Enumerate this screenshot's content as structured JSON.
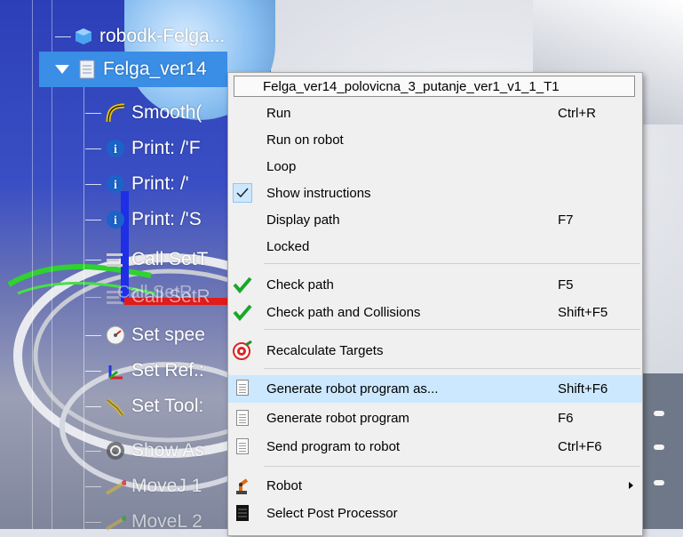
{
  "tree": {
    "items": [
      {
        "label": "robodk-Felga...",
        "icon": "cube-icon"
      },
      {
        "label": "Felga_ver14",
        "icon": "program-doc-icon"
      },
      {
        "label": "Smooth(",
        "icon": "smooth-curve-icon"
      },
      {
        "label": "Print: /'F",
        "icon": "info-icon"
      },
      {
        "label": "Print: /'",
        "icon": "info-icon"
      },
      {
        "label": "Print: /'S",
        "icon": "info-icon"
      },
      {
        "label": "Call SetT",
        "icon": "call-program-icon"
      },
      {
        "label": "Call SetR",
        "icon": "call-program-icon"
      },
      {
        "label": "Set spee",
        "icon": "speed-gauge-icon"
      },
      {
        "label": "Set Ref.:",
        "icon": "reference-frame-icon"
      },
      {
        "label": "Set Tool:",
        "icon": "tool-icon"
      },
      {
        "label": "Show As",
        "icon": "refresh-icon"
      },
      {
        "label": "MoveJ 1",
        "icon": "move-joint-icon"
      },
      {
        "label": "MoveL 2",
        "icon": "move-linear-icon"
      }
    ]
  },
  "viewport": {
    "overlay_text": "Call SetR"
  },
  "context_menu": {
    "title": "Felga_ver14_polovicna_3_putanje_ver1_v1_1_T1",
    "items": [
      {
        "label": "Run",
        "shortcut": "Ctrl+R"
      },
      {
        "label": "Run on robot",
        "shortcut": ""
      },
      {
        "label": "Loop",
        "shortcut": ""
      },
      {
        "label": "Show instructions",
        "shortcut": "",
        "checked": true
      },
      {
        "label": "Display path",
        "shortcut": "F7"
      },
      {
        "label": "Locked",
        "shortcut": ""
      },
      {
        "label": "Check path",
        "shortcut": "F5",
        "icon": "green-check-icon"
      },
      {
        "label": "Check path and Collisions",
        "shortcut": "Shift+F5",
        "icon": "green-check-icon"
      },
      {
        "label": "Recalculate Targets",
        "shortcut": "",
        "icon": "target-icon"
      },
      {
        "label": "Generate robot program as...",
        "shortcut": "Shift+F6",
        "icon": "document-icon",
        "highlighted": true
      },
      {
        "label": "Generate robot program",
        "shortcut": "F6",
        "icon": "document-icon"
      },
      {
        "label": "Send program to robot",
        "shortcut": "Ctrl+F6",
        "icon": "document-icon"
      },
      {
        "label": "Robot",
        "shortcut": "",
        "icon": "robot-arm-icon",
        "submenu": true
      },
      {
        "label": "Select Post Processor",
        "shortcut": "",
        "icon": "black-doc-icon"
      }
    ]
  },
  "colors": {
    "selection": "#3a8ee6",
    "menu_highlight": "#cce8ff",
    "check_green": "#18a82a",
    "menu_bg": "#f0f0f0"
  }
}
